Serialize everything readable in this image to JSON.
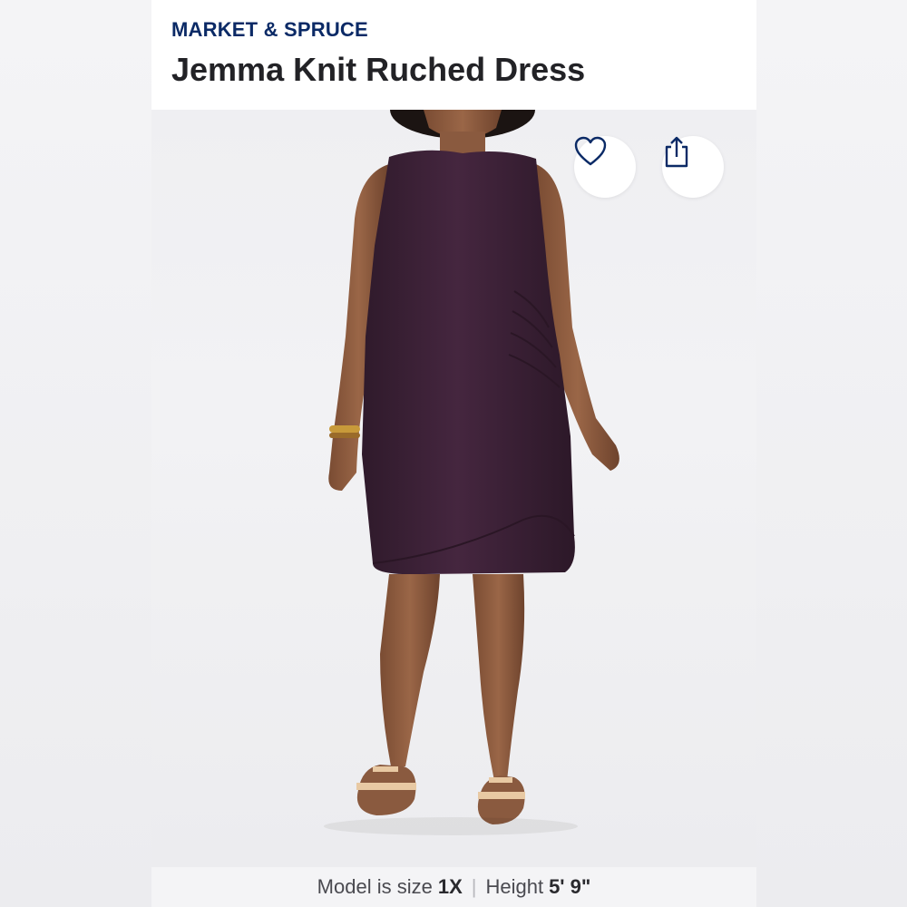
{
  "brand": "MARKET & SPRUCE",
  "product": {
    "title": "Jemma Knit Ruched Dress"
  },
  "actions": {
    "favorite_icon": "heart-outline-icon",
    "share_icon": "share-upload-icon"
  },
  "caption": {
    "size_label": "Model is size",
    "size_value": "1X",
    "separator": "|",
    "height_label": "Height",
    "height_value": "5' 9\""
  },
  "colors": {
    "brand": "#0b2a66",
    "dress": "#3e2238",
    "skin": "#8a5a3f"
  }
}
